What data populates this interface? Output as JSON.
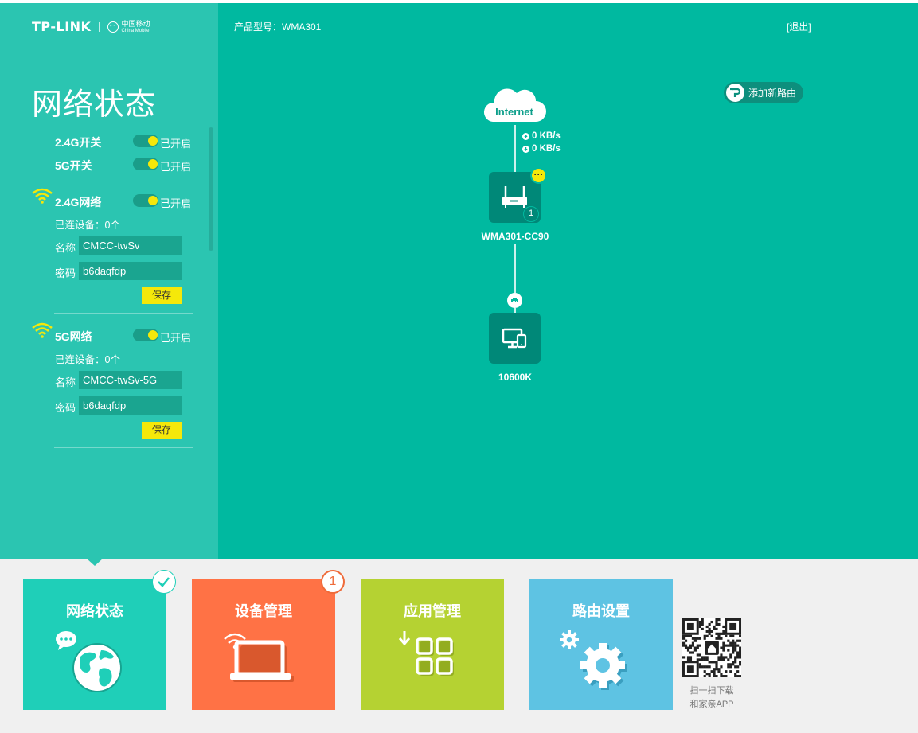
{
  "brand": {
    "logo_text": "TP-LINK",
    "partner_cn": "中国移动",
    "partner_en": "China Mobile"
  },
  "header": {
    "model": "产品型号：WMA301",
    "logout": "[退出]"
  },
  "sidebar": {
    "title": "网络状态",
    "switch_24": {
      "label": "2.4G开关",
      "status": "已开启"
    },
    "switch_5": {
      "label": "5G开关",
      "status": "已开启"
    },
    "net_24": {
      "label": "2.4G网络",
      "status": "已开启",
      "connected": "已连设备：0个",
      "name_label": "名称",
      "name_value": "CMCC-twSv",
      "pwd_label": "密码",
      "pwd_value": "b6daqfdp",
      "save": "保存"
    },
    "net_5": {
      "label": "5G网络",
      "status": "已开启",
      "connected": "已连设备：0个",
      "name_label": "名称",
      "name_value": "CMCC-twSv-5G",
      "pwd_label": "密码",
      "pwd_value": "b6daqfdp",
      "save": "保存"
    }
  },
  "topology": {
    "add_router": "添加新路由",
    "internet": "Internet",
    "upload": "0 KB/s",
    "download": "0 KB/s",
    "router_name": "WMA301-CC90",
    "router_badge": "1",
    "more": "···",
    "device_name": "10600K"
  },
  "tiles": {
    "status": "网络状态",
    "devices": "设备管理",
    "devices_badge": "1",
    "apps": "应用管理",
    "router": "路由设置"
  },
  "qr": {
    "line1": "扫一扫下载",
    "line2": "和家亲APP"
  },
  "colors": {
    "main_bg": "#00b9a0",
    "sidebar_bg": "#2bc5b1",
    "toggle_on": "#f5e80a",
    "tile_status": "#1fcfb8",
    "tile_devices": "#ff7245",
    "tile_apps": "#b5d232",
    "tile_router": "#5ec3e3"
  }
}
